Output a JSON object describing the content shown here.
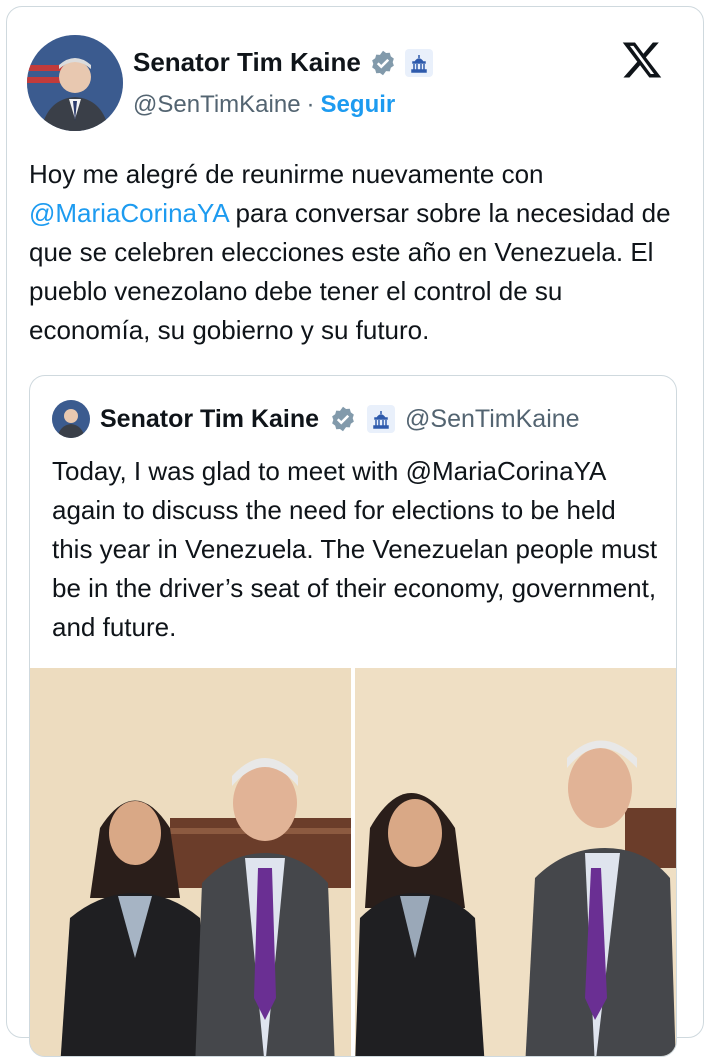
{
  "post": {
    "author_name": "Senator Tim Kaine",
    "handle": "@SenTimKaine",
    "separator": "·",
    "follow_label": "Seguir",
    "text_before": "Hoy me alegré de reunirme nuevamente con ",
    "mention": "@MariaCorinaYA",
    "text_after": " para conversar sobre la necesidad de que se celebren elecciones este año en Venezuela. El pueblo venezolano debe tener el control de su economía, su gobierno y su futuro."
  },
  "quoted": {
    "author_name": "Senator Tim Kaine",
    "handle": "@SenTimKaine",
    "text": "Today, I was glad to meet with @MariaCorinaYA again to discuss the need for elections to be held this year in Venezuela. The Venezuelan people must be in the driver’s seat of their economy, government, and future."
  },
  "colors": {
    "accent": "#1d9bf0",
    "verified_gray": "#829aab",
    "text": "#0f1419",
    "muted": "#536471"
  }
}
